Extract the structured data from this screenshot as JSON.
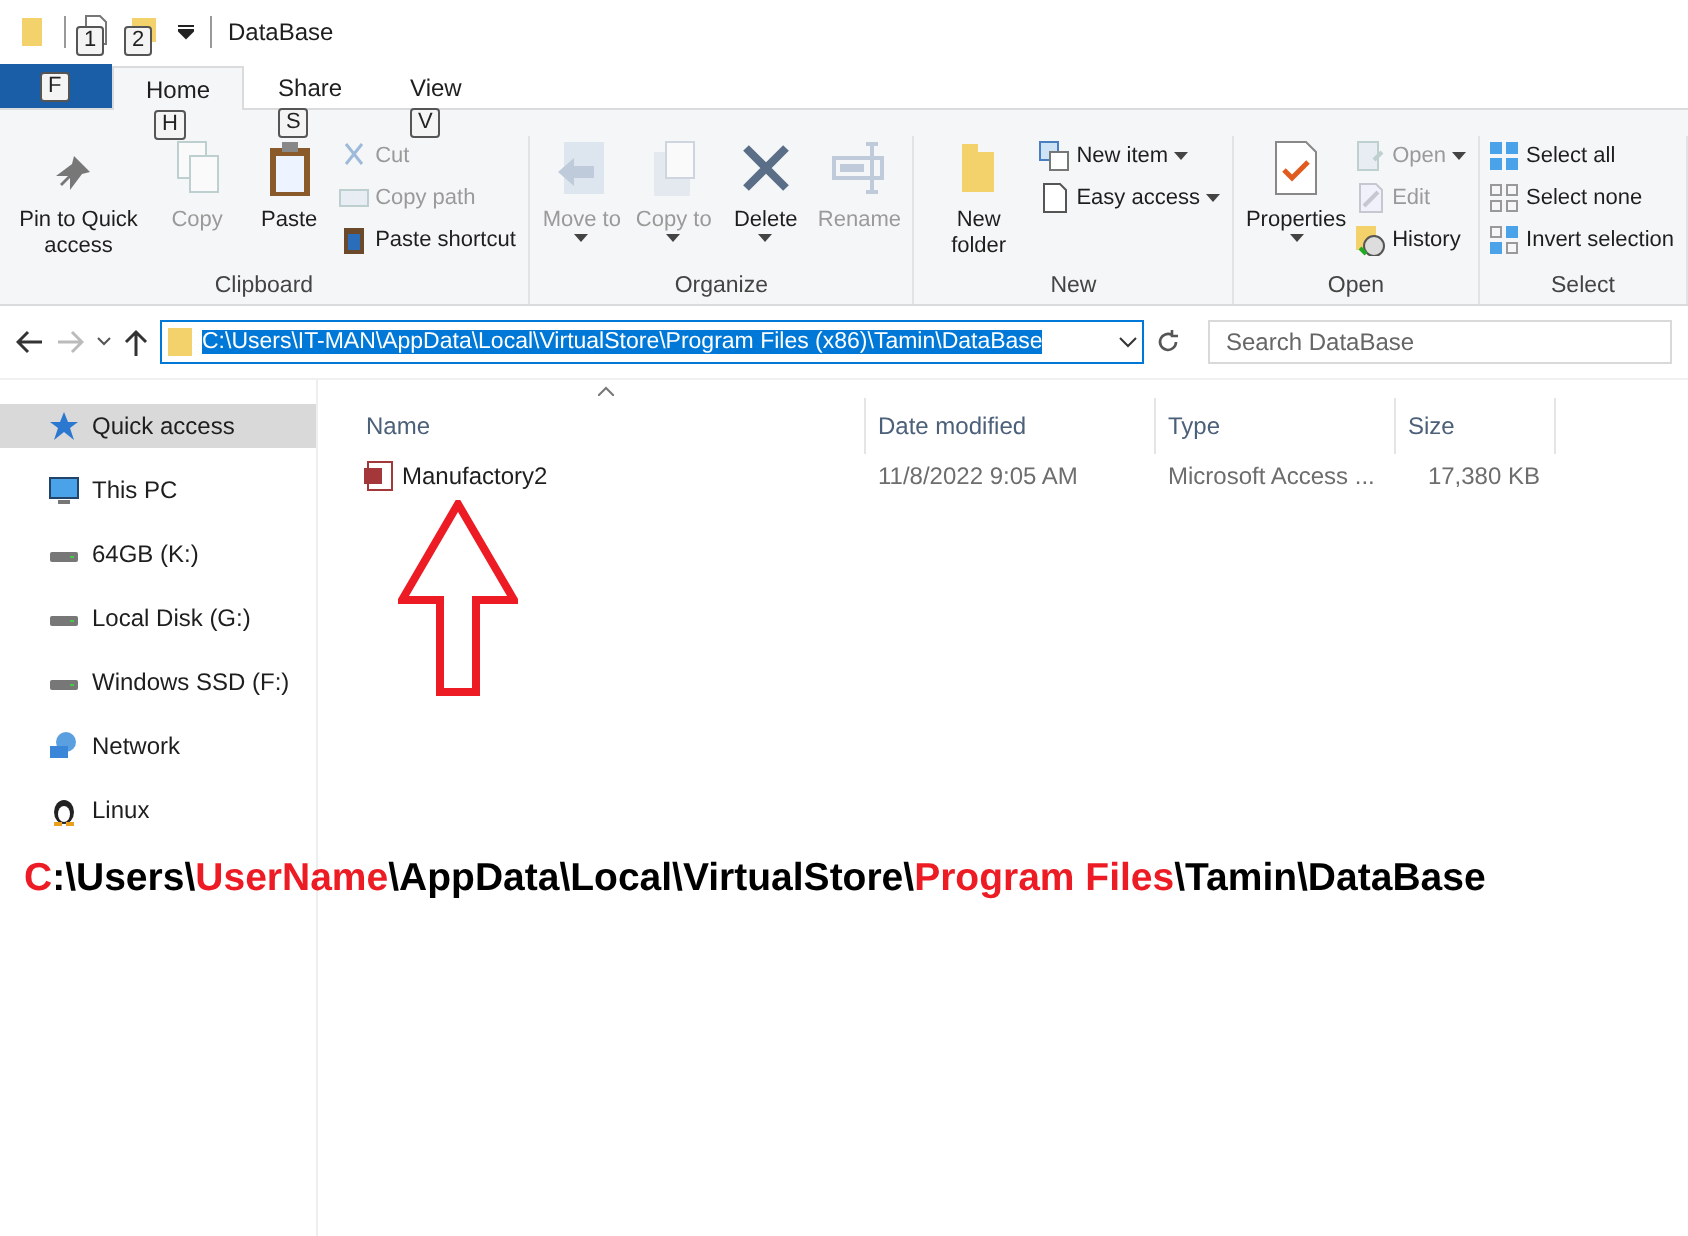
{
  "window": {
    "title": "DataBase",
    "quick_access_keytips": [
      "1",
      "2"
    ]
  },
  "tabs": [
    {
      "keytip": "F",
      "kind": "file",
      "selected": false
    },
    {
      "label": "Home",
      "keytip": "H",
      "kind": "tab",
      "selected": true
    },
    {
      "label": "Share",
      "keytip": "S",
      "kind": "tab",
      "selected": false
    },
    {
      "label": "View",
      "keytip": "V",
      "kind": "tab",
      "selected": false
    }
  ],
  "ribbon": [
    {
      "label": "Clipboard",
      "items": [
        {
          "label": "Pin to Quick access",
          "kind": "large",
          "disabled": false,
          "menu": false
        },
        {
          "label": "Copy",
          "kind": "large",
          "disabled": true,
          "menu": false
        },
        {
          "label": "Paste",
          "kind": "large",
          "disabled": false,
          "menu": false
        },
        {
          "label": "Cut",
          "kind": "small",
          "disabled": true,
          "menu": false
        },
        {
          "label": "Copy path",
          "kind": "small",
          "disabled": true,
          "menu": false
        },
        {
          "label": "Paste shortcut",
          "kind": "small",
          "disabled": false,
          "menu": false
        }
      ]
    },
    {
      "label": "Organize",
      "items": [
        {
          "label": "Move to",
          "kind": "large",
          "disabled": true,
          "menu": true
        },
        {
          "label": "Copy to",
          "kind": "large",
          "disabled": true,
          "menu": true
        },
        {
          "label": "Delete",
          "kind": "large",
          "disabled": false,
          "menu": true
        },
        {
          "label": "Rename",
          "kind": "large",
          "disabled": true,
          "menu": false
        }
      ]
    },
    {
      "label": "New",
      "items": [
        {
          "label": "New folder",
          "kind": "large",
          "disabled": false,
          "menu": false
        },
        {
          "label": "New item",
          "kind": "small",
          "disabled": false,
          "menu": true
        },
        {
          "label": "Easy access",
          "kind": "small",
          "disabled": false,
          "menu": true
        }
      ]
    },
    {
      "label": "Open",
      "items": [
        {
          "label": "Properties",
          "kind": "large",
          "disabled": false,
          "menu": true
        },
        {
          "label": "Open",
          "kind": "small",
          "disabled": true,
          "menu": true
        },
        {
          "label": "Edit",
          "kind": "small",
          "disabled": true,
          "menu": false
        },
        {
          "label": "History",
          "kind": "small",
          "disabled": false,
          "menu": false
        }
      ]
    },
    {
      "label": "Select",
      "items": [
        {
          "label": "Select all",
          "kind": "small",
          "disabled": false,
          "menu": false
        },
        {
          "label": "Select none",
          "kind": "small",
          "disabled": false,
          "menu": false
        },
        {
          "label": "Invert selection",
          "kind": "small",
          "disabled": false,
          "menu": false
        }
      ]
    }
  ],
  "address_bar": {
    "path": "C:\\Users\\IT-MAN\\AppData\\Local\\VirtualStore\\Program Files (x86)\\Tamin\\DataBase",
    "forward_disabled": true
  },
  "search": {
    "placeholder": "Search DataBase"
  },
  "sidebar": {
    "items": [
      {
        "label": "Quick access",
        "selected": true
      },
      {
        "label": "This PC",
        "selected": false
      },
      {
        "label": "64GB (K:)",
        "selected": false
      },
      {
        "label": "Local Disk (G:)",
        "selected": false
      },
      {
        "label": "Windows SSD (F:)",
        "selected": false
      },
      {
        "label": "Network",
        "selected": false
      },
      {
        "label": "Linux",
        "selected": false
      }
    ]
  },
  "table": {
    "columns": [
      "Name",
      "Date modified",
      "Type",
      "Size"
    ],
    "rows": [
      [
        "Manufactory2",
        "11/8/2022 9:05 AM",
        "Microsoft Access ...",
        "17,380 KB"
      ]
    ]
  },
  "annotation": {
    "segments": [
      {
        "text": "C",
        "highlight": true
      },
      {
        "text": ":\\Users\\",
        "highlight": false
      },
      {
        "text": "UserName",
        "highlight": true
      },
      {
        "text": "\\AppData\\Local\\VirtualStore\\",
        "highlight": false
      },
      {
        "text": "Program Files",
        "highlight": true
      },
      {
        "text": "\\Tamin\\DataBase",
        "highlight": false
      }
    ]
  }
}
